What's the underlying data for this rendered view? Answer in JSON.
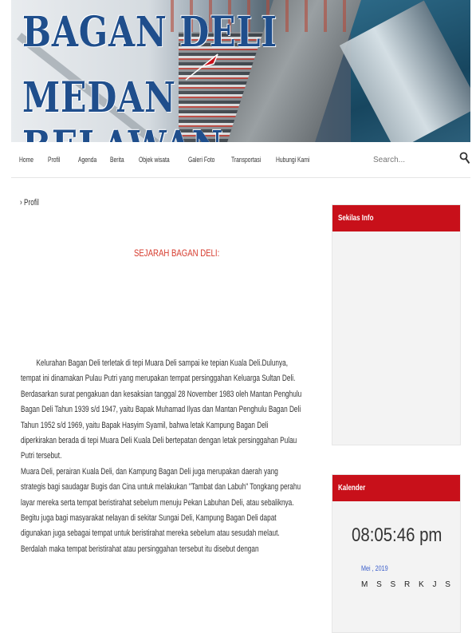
{
  "header": {
    "title_line1": "BAGAN DELI",
    "title_line2": "MEDAN BELAWAN"
  },
  "nav": {
    "items": [
      "Home",
      "Profil",
      "Agenda",
      "Berita",
      "Objek wisata",
      "Galeri Foto",
      "Transportasi",
      "Hubungi Kami"
    ],
    "search_placeholder": "Search..."
  },
  "breadcrumb": "› Profil",
  "article": {
    "title": "SEJARAH BAGAN DELI:",
    "paragraphs": [
      "Kelurahan Bagan Deli terletak di tepi Muara Deli sampai ke tepian Kuala Deli.Dulunya, tempat ini dinamakan Pulau Putri yang merupakan tempat persinggahan Keluarga Sultan Deli. Berdasarkan surat pengakuan dan kesaksian tanggal 28 November 1983 oleh Mantan Penghulu Bagan Deli Tahun 1939 s/d 1947, yaitu Bapak Muhamad Ilyas dan Mantan Penghulu Bagan Deli Tahun 1952 s/d 1969, yaitu Bapak Hasyim Syamil, bahwa letak Kampung Bagan Deli diperkirakan berada di tepi   Muara Deli Kuala Deli bertepatan dengan letak persinggahan Pulau Putri tersebut.",
      "Muara Deli, perairan Kuala Deli, dan Kampung Bagan Deli juga merupakan daerah yang strategis bagi saudagar Bugis dan Cina untuk melakukan \"Tambat dan Labuh\" Tongkang perahu layar mereka serta tempat beristirahat sebelum menuju Pekan Labuhan Deli, atau sebaliknya. Begitu juga bagi masyarakat nelayan di sekitar Sungai Deli, Kampung Bagan Deli dapat digunakan juga sebagai tempat untuk beristirahat mereka sebelum atau sesudah melaut. Berdalah maka tempat beristirahat atau persinggahan tersebut itu disebut dengan"
    ]
  },
  "sidebar": {
    "widget1_title": "Sekilas Info",
    "widget2_title": "Kalender",
    "clock": "08:05:46 pm",
    "month": "Mei , 2019",
    "days": "M S S R K J S"
  },
  "colors": {
    "widget_header": "#c8101a",
    "title_red": "#d63a2c",
    "banner_text": "#1f4e8c"
  },
  "icons": {
    "search": "search-icon"
  }
}
